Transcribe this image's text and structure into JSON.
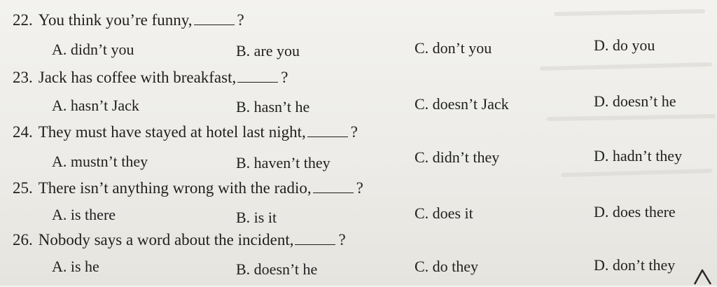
{
  "questions": [
    {
      "number": "22.",
      "stem": "You think you’re funny,",
      "end": "?",
      "options": {
        "a": "A. didn’t you",
        "b": "B. are you",
        "c": "C. don’t you",
        "d": "D. do you"
      }
    },
    {
      "number": "23.",
      "stem": "Jack has coffee with breakfast,",
      "end": "?",
      "options": {
        "a": "A. hasn’t Jack",
        "b": "B. hasn’t he",
        "c": "C. doesn’t Jack",
        "d": "D. doesn’t he"
      }
    },
    {
      "number": "24.",
      "stem": "They must have stayed at hotel last night,",
      "end": "?",
      "options": {
        "a": "A. mustn’t they",
        "b": "B. haven’t they",
        "c": "C. didn’t they",
        "d": "D. hadn’t they"
      }
    },
    {
      "number": "25.",
      "stem": "There isn’t anything wrong with the radio,",
      "end": "?",
      "options": {
        "a": "A. is there",
        "b": "B. is it",
        "c": "C. does it",
        "d": "D. does there"
      }
    },
    {
      "number": "26.",
      "stem": "Nobody says a word about the incident,",
      "end": "?",
      "options": {
        "a": "A. is he",
        "b": "B. doesn’t he",
        "c": "C. do they",
        "d": "D. don’t they"
      }
    }
  ]
}
